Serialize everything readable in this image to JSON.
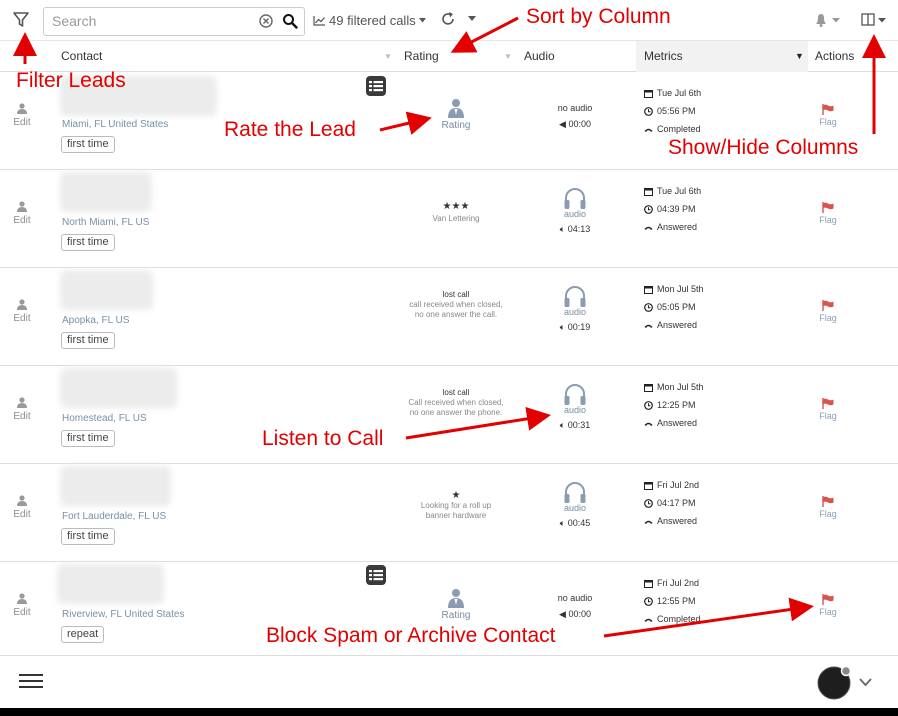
{
  "toolbar": {
    "search_placeholder": "Search",
    "filtered_count": "49 filtered calls"
  },
  "columns": {
    "contact": "Contact",
    "rating": "Rating",
    "audio": "Audio",
    "metrics": "Metrics",
    "actions": "Actions"
  },
  "rows": [
    {
      "edit": "Edit",
      "location": "Miami, FL United States",
      "badge": "first time",
      "rating_label": "Rating",
      "audio_status": "no audio",
      "duration": "00:00",
      "date": "Tue Jul 6th",
      "time": "05:56 PM",
      "status": "Completed",
      "flag": "Flag"
    },
    {
      "edit": "Edit",
      "location": "North Miami, FL US",
      "badge": "first time",
      "stars": "★★★",
      "rating_note": "Van Lettering",
      "audio_label": "audio",
      "duration": "04:13",
      "date": "Tue Jul 6th",
      "time": "04:39 PM",
      "status": "Answered",
      "flag": "Flag"
    },
    {
      "edit": "Edit",
      "location": "Apopka, FL US",
      "badge": "first time",
      "rating_title": "lost call",
      "rating_note": "call received when closed, no one answer the call.",
      "audio_label": "audio",
      "duration": "00:19",
      "date": "Mon Jul 5th",
      "time": "05:05 PM",
      "status": "Answered",
      "flag": "Flag"
    },
    {
      "edit": "Edit",
      "location": "Homestead, FL US",
      "badge": "first time",
      "rating_title": "lost call",
      "rating_note": "Call received when closed, no one answer the phone.",
      "audio_label": "audio",
      "duration": "00:31",
      "date": "Mon Jul 5th",
      "time": "12:25 PM",
      "status": "Answered",
      "flag": "Flag"
    },
    {
      "edit": "Edit",
      "location": "Fort Lauderdale, FL US",
      "badge": "first time",
      "stars": "★",
      "rating_note": "Looking for a roll up banner hardware",
      "audio_label": "audio",
      "duration": "00:45",
      "date": "Fri Jul 2nd",
      "time": "04:17 PM",
      "status": "Answered",
      "flag": "Flag"
    },
    {
      "edit": "Edit",
      "location": "Riverview, FL United States",
      "badge": "repeat",
      "rating_label": "Rating",
      "audio_status": "no audio",
      "duration": "00:00",
      "date": "Fri Jul 2nd",
      "time": "12:55 PM",
      "status": "Completed",
      "flag": "Flag"
    }
  ],
  "annotations": {
    "filter": "Filter Leads",
    "sort": "Sort by Column",
    "rate": "Rate the Lead",
    "columns": "Show/Hide Columns",
    "listen": "Listen to Call",
    "block": "Block Spam or Archive Contact"
  },
  "colors": {
    "annotation": "#e30000",
    "flag": "#d9534f",
    "link": "#7890a8"
  }
}
